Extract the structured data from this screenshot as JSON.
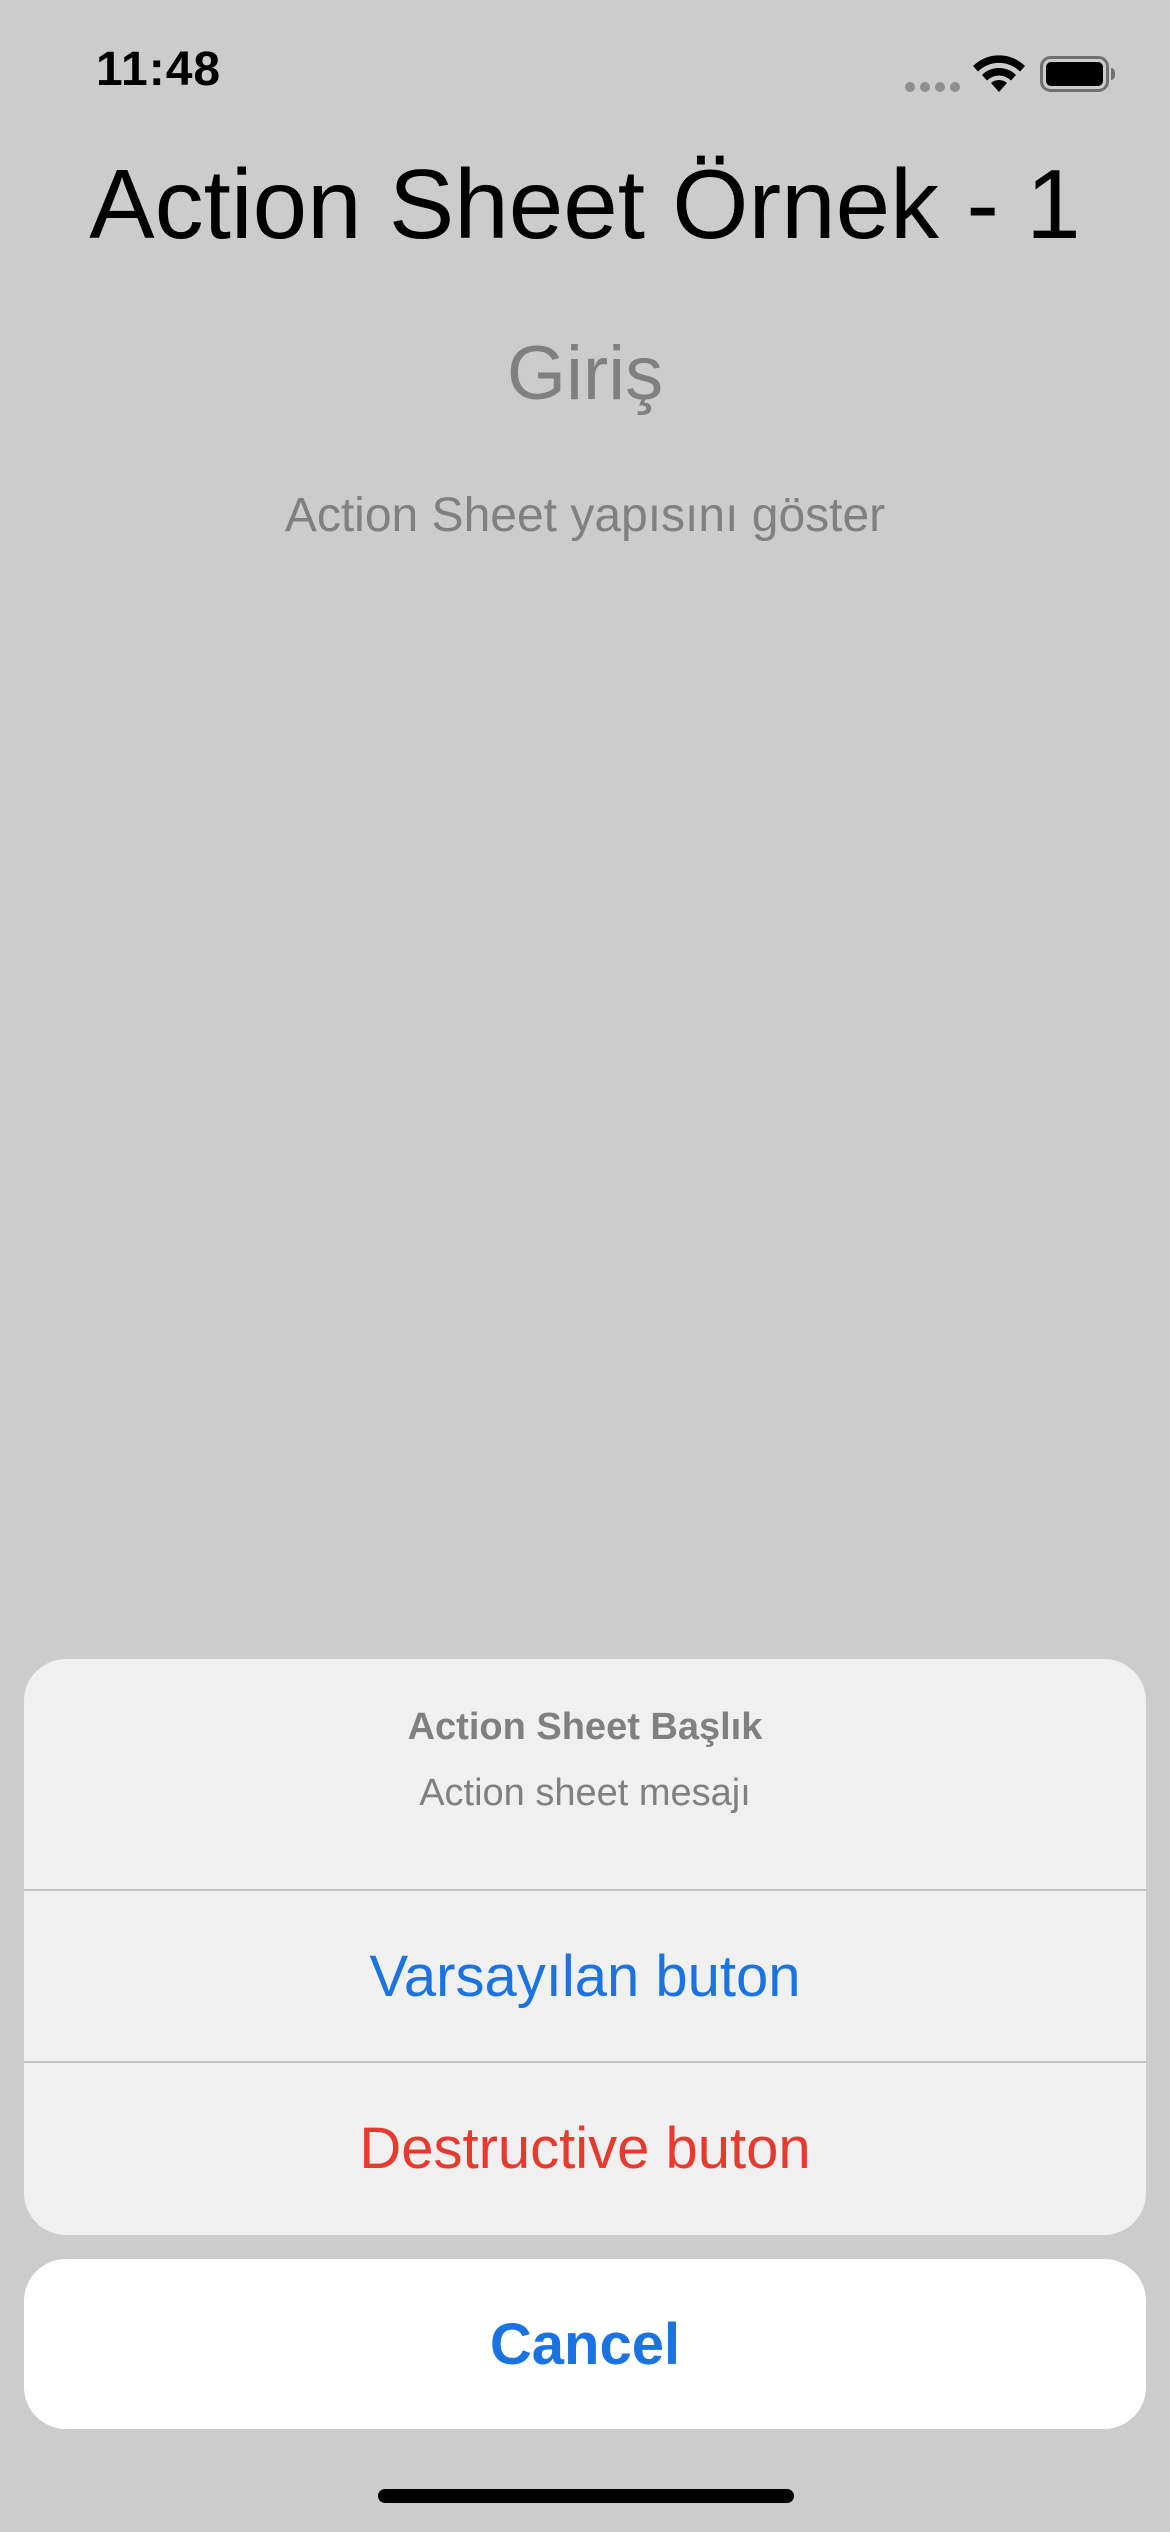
{
  "status_bar": {
    "time": "11:48"
  },
  "screen": {
    "title": "Action Sheet Örnek - 1",
    "section_title": "Giriş",
    "section_description": "Action Sheet yapısını göster"
  },
  "action_sheet": {
    "title": "Action Sheet Başlık",
    "message": "Action sheet mesajı",
    "actions": [
      {
        "label": "Varsayılan buton",
        "style": "default"
      },
      {
        "label": "Destructive buton",
        "style": "destructive"
      }
    ],
    "cancel_label": "Cancel"
  },
  "colors": {
    "background": "#cccccc",
    "sheet_background": "#f0f0f0",
    "accent_blue": "#1a73e0",
    "destructive_red": "#e8392f",
    "secondary_text": "#808080"
  },
  "icons": {
    "signal": "cellular-signal-icon",
    "wifi": "wifi-icon",
    "battery": "battery-icon"
  }
}
